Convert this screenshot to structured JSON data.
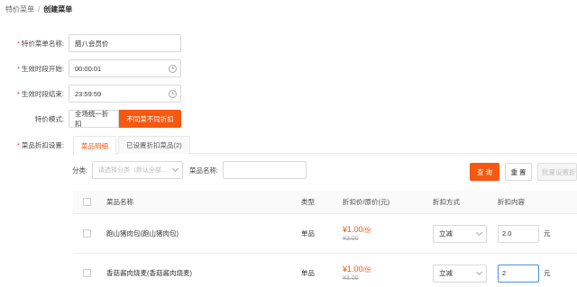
{
  "breadcrumb": {
    "parent": "特价菜单",
    "separator": "/",
    "current": "创建菜单"
  },
  "form": {
    "name": {
      "label": "特价菜单名称:",
      "value": "腊八会员价"
    },
    "start": {
      "label": "生效时段开始:",
      "value": "00:00:01"
    },
    "end": {
      "label": "生效时段结束:",
      "value": "23:59:59"
    },
    "mode": {
      "label": "特价模式:",
      "options": [
        "全场统一折扣",
        "不同菜不同折扣"
      ],
      "selected": "不同菜不同折扣"
    },
    "discount_settings": {
      "label": "菜品折扣设置:"
    }
  },
  "tabs": [
    {
      "label": "菜品明细",
      "active": true
    },
    {
      "label": "已设置折扣菜品(2)",
      "active": false
    }
  ],
  "filter": {
    "category_label": "分类:",
    "category_placeholder": "请选择分类（默认全部...",
    "dish_label": "菜品名称:",
    "dish_value": "",
    "query_btn": "查 询",
    "reset_btn": "重 置",
    "batch_btn": "批量设置折"
  },
  "table": {
    "headers": {
      "name": "菜品名称",
      "type": "类型",
      "price": "折扣价/原价(元)",
      "method": "折扣方式",
      "content": "折扣内容"
    },
    "rows": [
      {
        "name": "跑山猪肉包(跑山猪肉包)",
        "type": "单品",
        "price_now": "¥1.00",
        "price_unit": "/份",
        "price_orig": "¥3.00",
        "method": "立减",
        "content": "2.0",
        "unit": "元"
      },
      {
        "name": "香菇酱肉烧麦(香菇酱肉烧麦)",
        "type": "单品",
        "price_now": "¥1.00",
        "price_unit": "/份",
        "price_orig": "¥3.00",
        "method": "立减",
        "content": "2",
        "unit": "元"
      }
    ]
  },
  "colors": {
    "accent": "#f5580f",
    "required": "#f5222d",
    "focus": "#4a90e2"
  }
}
